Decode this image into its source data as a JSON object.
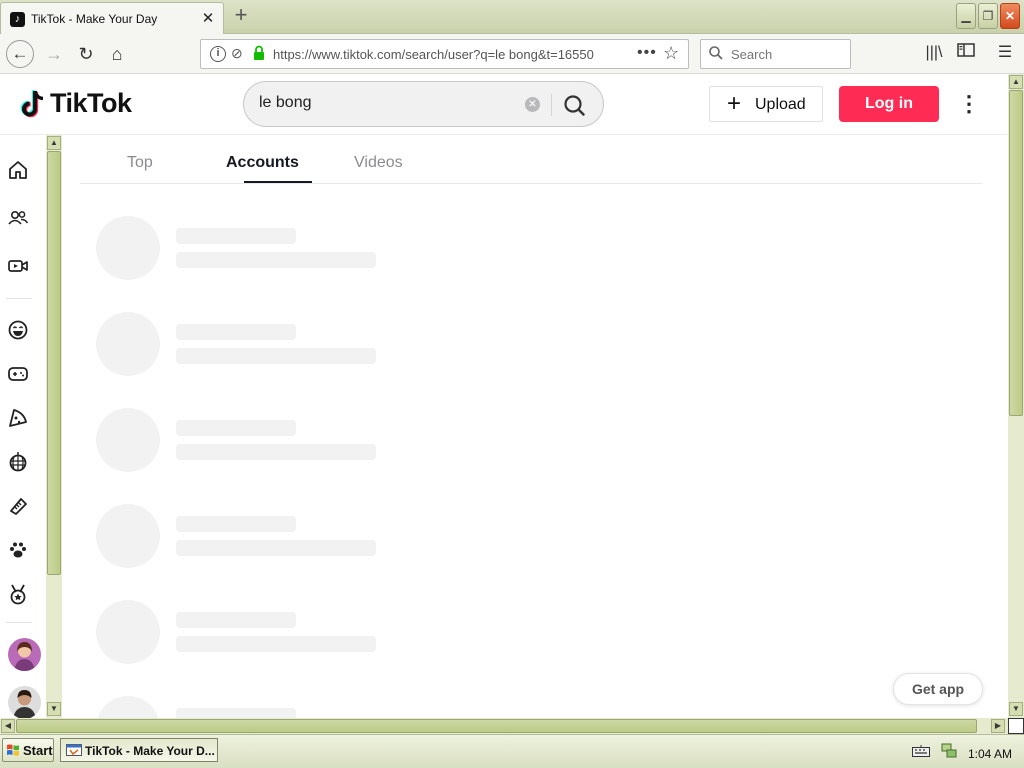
{
  "browser": {
    "tab_title": "TikTok - Make Your Day",
    "tab_favicon": "tiktok-note-icon",
    "url": "https://www.tiktok.com/search/user?q=le bong&t=16550",
    "search_placeholder": "Search",
    "window_buttons": [
      "minimize",
      "restore",
      "close"
    ]
  },
  "header": {
    "logo_text": "TikTok",
    "search_value": "le bong",
    "upload_label": "Upload",
    "login_label": "Log in"
  },
  "sidebar": {
    "icons": [
      "home-icon",
      "following-icon",
      "live-icon",
      "comedy-icon",
      "gaming-icon",
      "food-icon",
      "dance-icon",
      "beauty-icon",
      "animals-icon",
      "sports-icon"
    ]
  },
  "search_tabs": [
    {
      "label": "Top",
      "active": false
    },
    {
      "label": "Accounts",
      "active": true
    },
    {
      "label": "Videos",
      "active": false
    }
  ],
  "get_app_label": "Get app",
  "taskbar": {
    "start_label": "Start",
    "task_label": "TikTok - Make Your D...",
    "clock": "1:04 AM"
  },
  "colors": {
    "accent": "#fe2c55",
    "skeleton": "#f2f2f2",
    "xp_bar": "#d9dfc2"
  }
}
